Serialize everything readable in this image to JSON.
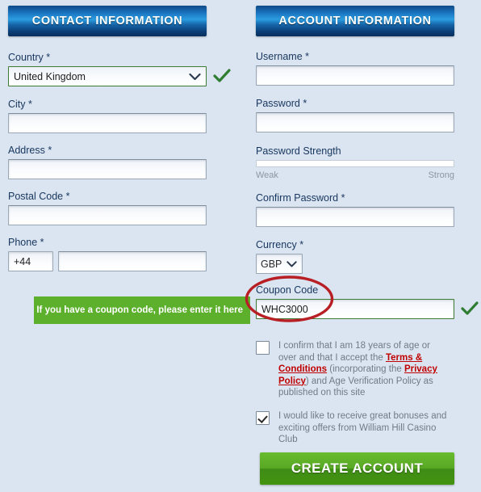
{
  "theme": {
    "page_background": "#dbe5f1",
    "header_blue": "#1a71bd",
    "accent_green": "#5cb02c",
    "valid_green": "#3d7a33",
    "link_red": "#c00000",
    "annotation_red": "#b81f24",
    "cta_green": "#59a925"
  },
  "contact": {
    "header": "CONTACT INFORMATION",
    "country": {
      "label": "Country",
      "required": "*",
      "value": "United Kingdom",
      "options": [
        "United Kingdom"
      ],
      "valid": true
    },
    "city": {
      "label": "City",
      "required": "*",
      "value": "",
      "placeholder": ""
    },
    "address": {
      "label": "Address",
      "required": "*",
      "value": "",
      "placeholder": ""
    },
    "postal_code": {
      "label": "Postal Code",
      "required": "*",
      "value": "",
      "placeholder": ""
    },
    "phone": {
      "label": "Phone",
      "required": "*",
      "prefix": "+44",
      "value": "",
      "placeholder": ""
    }
  },
  "account": {
    "header": "ACCOUNT INFORMATION",
    "username": {
      "label": "Username",
      "required": "*",
      "value": "",
      "placeholder": ""
    },
    "password": {
      "label": "Password",
      "required": "*",
      "value": "",
      "placeholder": ""
    },
    "password_strength": {
      "label": "Password Strength",
      "weak_label": "Weak",
      "strong_label": "Strong",
      "percent": 0
    },
    "confirm_password": {
      "label": "Confirm Password",
      "required": "*",
      "value": "",
      "placeholder": ""
    },
    "currency": {
      "label": "Currency",
      "required": "*",
      "value": "GBP",
      "options": [
        "GBP"
      ]
    },
    "coupon": {
      "label": "Coupon Code",
      "value": "WHC3000",
      "placeholder": "",
      "valid": true
    }
  },
  "callout": {
    "text": "If you have a coupon code, please enter it here"
  },
  "consents": [
    {
      "checked": false,
      "parts": [
        {
          "t": "I confirm that I am 18 years of age or over and that I accept the ",
          "link": false
        },
        {
          "t": "Terms & Conditions",
          "link": true
        },
        {
          "t": " (incorporating the ",
          "link": false
        },
        {
          "t": "Privacy Policy",
          "link": true
        },
        {
          "t": ") and Age Verification Policy as published on this site",
          "link": false
        }
      ]
    },
    {
      "checked": true,
      "parts": [
        {
          "t": "I would like to receive great bonuses and exciting offers from William Hill Casino Club",
          "link": false
        }
      ]
    }
  ],
  "submit": {
    "label": "CREATE ACCOUNT"
  },
  "icons": {
    "tick": "check-mark",
    "chevron": "chevron-down"
  }
}
